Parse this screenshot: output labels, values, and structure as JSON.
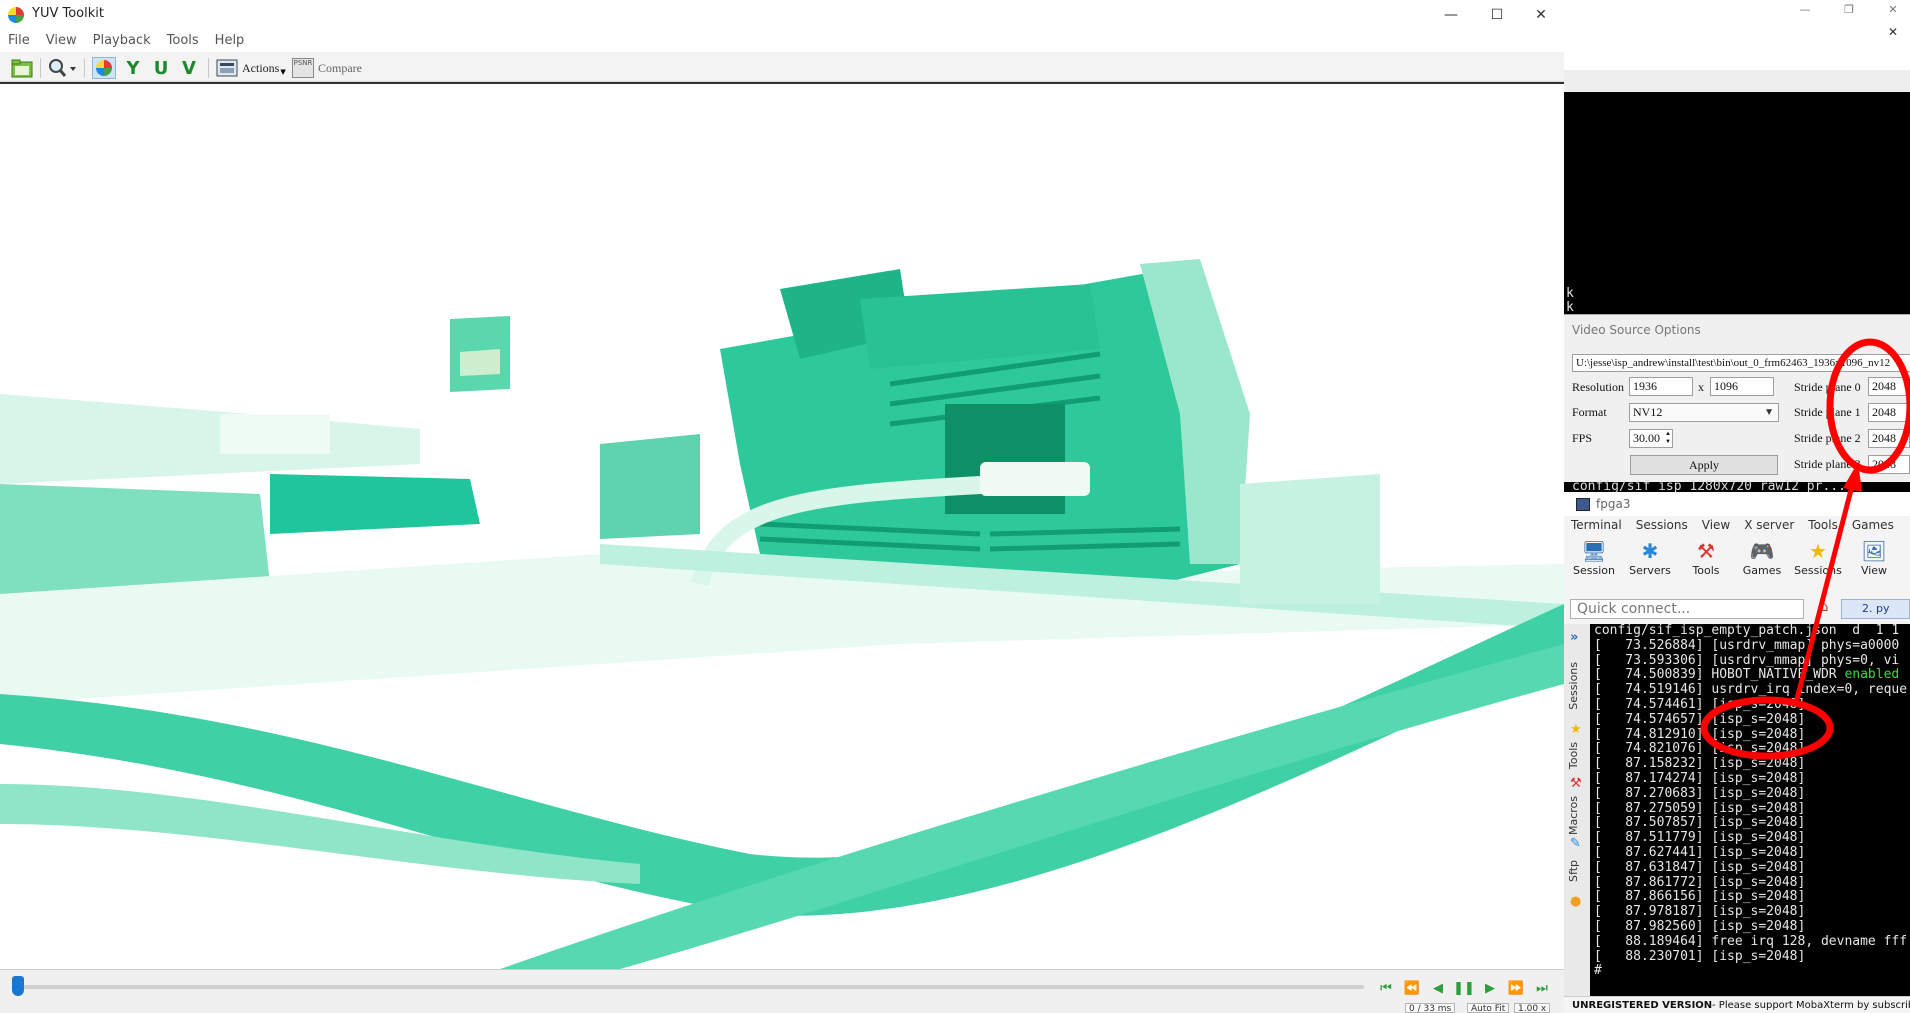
{
  "yuv_toolkit": {
    "title": "YUV Toolkit",
    "menu": [
      "File",
      "View",
      "Playback",
      "Tools",
      "Help"
    ],
    "toolbar": {
      "open_icon": "folder-open-icon",
      "zoom_icon": "magnifier-icon",
      "color_icon": "color-wheel-icon",
      "y_label": "Y",
      "u_label": "U",
      "v_label": "V",
      "actions_label": "Actions",
      "compare_icon_label": "PSNR",
      "compare_label": "Compare"
    },
    "status": {
      "time": "0 / 33 ms",
      "fit": "Auto Fit",
      "zoom": "1.00 x"
    },
    "seek_position": 0.003
  },
  "video_source_options": {
    "caption": "Video Source Options",
    "path": "U:\\jesse\\isp_andrew\\install\\test\\bin\\out_0_frm62463_1936x1096_nv12",
    "resolution_label": "Resolution",
    "width": "1936",
    "x_label": "x",
    "height": "1096",
    "format_label": "Format",
    "format": "NV12",
    "fps_label": "FPS",
    "fps": "30.00",
    "apply_label": "Apply",
    "strides": [
      {
        "label": "Stride plane 0",
        "value": "2048"
      },
      {
        "label": "Stride plane 1",
        "value": "2048"
      },
      {
        "label": "Stride plane 2",
        "value": "2048"
      },
      {
        "label": "Stride plane 3",
        "value": "2048"
      }
    ]
  },
  "background_terminal": {
    "lines": [
      "k",
      "k"
    ]
  },
  "mobaxterm": {
    "strip_text": "config/sif_isp_1280x720_raw12_pr...",
    "title": "fpga3",
    "menu": [
      "Terminal",
      "Sessions",
      "View",
      "X server",
      "Tools",
      "Games"
    ],
    "tools": [
      {
        "label": "Session",
        "icon": "session-icon"
      },
      {
        "label": "Servers",
        "icon": "servers-icon"
      },
      {
        "label": "Tools",
        "icon": "tools-icon"
      },
      {
        "label": "Games",
        "icon": "games-icon"
      },
      {
        "label": "Sessions",
        "icon": "star-icon"
      },
      {
        "label": "View",
        "icon": "view-icon"
      }
    ],
    "quick_connect_placeholder": "Quick connect...",
    "tab_label": "2. py",
    "side_tabs": [
      "Sessions",
      "Tools",
      "Macros",
      "Sftp"
    ],
    "terminal_lines": [
      "config/sif_isp_empty_patch.json  d  1 1",
      "[   73.526884] [usrdrv_mmap] phys=a0000",
      "[   73.593306] [usrdrv_mmap] phys=0, vi",
      "[   74.500839] HOBOT_NATIVE_WDR enabled",
      "[   74.519146] usrdrv_irq index=0, reque",
      "[   74.574461] [isp_s=2048]",
      "[   74.574657] [isp_s=2048]",
      "[   74.812910] [isp_s=2048]",
      "[   74.821076] [isp_s=2048]",
      "[   87.158232] [isp_s=2048]",
      "[   87.174274] [isp_s=2048]",
      "[   87.270683] [isp_s=2048]",
      "[   87.275059] [isp_s=2048]",
      "[   87.507857] [isp_s=2048]",
      "[   87.511779] [isp_s=2048]",
      "[   87.627441] [isp_s=2048]",
      "[   87.631847] [isp_s=2048]",
      "[   87.861772] [isp_s=2048]",
      "[   87.866156] [isp_s=2048]",
      "[   87.978187] [isp_s=2048]",
      "[   87.982560] [isp_s=2048]",
      "[   88.189464] free irq 128, devname fff",
      "[   88.230701] [isp_s=2048]",
      "#"
    ],
    "status_unregistered": "UNREGISTERED VERSION",
    "status_support": "-  Please support MobaXterm by subscribi"
  },
  "colors": {
    "image_green": "#2ec99a",
    "annotation_red": "#ff0000",
    "terminal_green": "#3ddc3d"
  }
}
